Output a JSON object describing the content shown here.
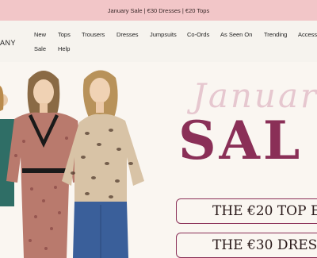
{
  "promo": {
    "text": "January Sale | €30 Dresses | €20 Tops"
  },
  "brand": {
    "partial_text": "ANY"
  },
  "nav": {
    "row1": [
      "New",
      "Tops",
      "Trousers",
      "Dresses",
      "Jumpsuits",
      "Co-Ords",
      "As Seen On",
      "Trending",
      "Accesso"
    ],
    "row2": [
      "Sale",
      "Help"
    ]
  },
  "hero": {
    "script_text": "Januar",
    "sale_text": "SAL",
    "cta_1": "THE €20 TOP E",
    "cta_2": "THE €30 DRESS",
    "accent_color": "#8a2f57",
    "script_color": "#e6c7cf"
  }
}
